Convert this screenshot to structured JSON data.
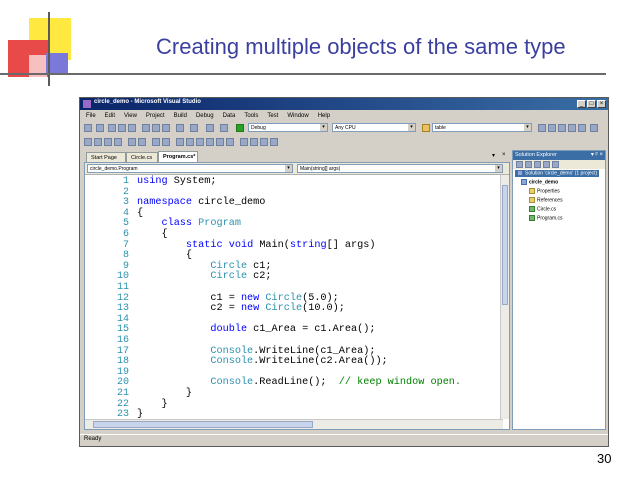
{
  "slide": {
    "title": "Creating multiple objects of the same type",
    "page_number": "30"
  },
  "window": {
    "title": "circle_demo - Microsoft Visual Studio",
    "minimize": "_",
    "restore": "□",
    "close": "×"
  },
  "menu": [
    "File",
    "Edit",
    "View",
    "Project",
    "Build",
    "Debug",
    "Data",
    "Tools",
    "Test",
    "Window",
    "Help"
  ],
  "toolbar": {
    "config": "Debug",
    "platform": "Any CPU",
    "find": "table"
  },
  "tabs": [
    {
      "label": "Start Page"
    },
    {
      "label": "Circle.cs"
    },
    {
      "label": "Program.cs*"
    }
  ],
  "tab_controls": {
    "dropdown": "▾",
    "close": "×"
  },
  "editor": {
    "type_combo": "circle_demo.Program",
    "member_combo": "Main(string[] args)"
  },
  "code": [
    {
      "n": "1",
      "segs": [
        [
          "kw",
          "using"
        ],
        [
          "p",
          " System;"
        ]
      ]
    },
    {
      "n": "2",
      "segs": []
    },
    {
      "n": "3",
      "segs": [
        [
          "kw",
          "namespace"
        ],
        [
          "p",
          " circle_demo"
        ]
      ]
    },
    {
      "n": "4",
      "segs": [
        [
          "p",
          "{"
        ]
      ]
    },
    {
      "n": "5",
      "segs": [
        [
          "p",
          "    "
        ],
        [
          "kw",
          "class"
        ],
        [
          "p",
          " "
        ],
        [
          "ty",
          "Program"
        ]
      ]
    },
    {
      "n": "6",
      "segs": [
        [
          "p",
          "    {"
        ]
      ]
    },
    {
      "n": "7",
      "segs": [
        [
          "p",
          "        "
        ],
        [
          "kw",
          "static"
        ],
        [
          "p",
          " "
        ],
        [
          "kw",
          "void"
        ],
        [
          "p",
          " Main("
        ],
        [
          "kw",
          "string"
        ],
        [
          "p",
          "[] args)"
        ]
      ]
    },
    {
      "n": "8",
      "segs": [
        [
          "p",
          "        {"
        ]
      ]
    },
    {
      "n": "9",
      "segs": [
        [
          "p",
          "            "
        ],
        [
          "ty",
          "Circle"
        ],
        [
          "p",
          " c1;"
        ]
      ]
    },
    {
      "n": "10",
      "segs": [
        [
          "p",
          "            "
        ],
        [
          "ty",
          "Circle"
        ],
        [
          "p",
          " c2;"
        ]
      ]
    },
    {
      "n": "11",
      "segs": []
    },
    {
      "n": "12",
      "segs": [
        [
          "p",
          "            c1 = "
        ],
        [
          "kw",
          "new"
        ],
        [
          "p",
          " "
        ],
        [
          "ty",
          "Circle"
        ],
        [
          "p",
          "(5.0);"
        ]
      ]
    },
    {
      "n": "13",
      "segs": [
        [
          "p",
          "            c2 = "
        ],
        [
          "kw",
          "new"
        ],
        [
          "p",
          " "
        ],
        [
          "ty",
          "Circle"
        ],
        [
          "p",
          "(10.0);"
        ]
      ]
    },
    {
      "n": "14",
      "segs": []
    },
    {
      "n": "15",
      "segs": [
        [
          "p",
          "            "
        ],
        [
          "kw",
          "double"
        ],
        [
          "p",
          " c1_Area = c1.Area();"
        ]
      ]
    },
    {
      "n": "16",
      "segs": []
    },
    {
      "n": "17",
      "segs": [
        [
          "p",
          "            "
        ],
        [
          "ty",
          "Console"
        ],
        [
          "p",
          ".WriteLine(c1_Area);"
        ]
      ]
    },
    {
      "n": "18",
      "segs": [
        [
          "p",
          "            "
        ],
        [
          "ty",
          "Console"
        ],
        [
          "p",
          ".WriteLine(c2.Area());"
        ]
      ]
    },
    {
      "n": "19",
      "segs": []
    },
    {
      "n": "20",
      "segs": [
        [
          "p",
          "            "
        ],
        [
          "ty",
          "Console"
        ],
        [
          "p",
          ".ReadLine();  "
        ],
        [
          "cm",
          "// keep window open."
        ]
      ]
    },
    {
      "n": "21",
      "segs": [
        [
          "p",
          "        }"
        ]
      ]
    },
    {
      "n": "22",
      "segs": [
        [
          "p",
          "    }"
        ]
      ]
    },
    {
      "n": "23",
      "segs": [
        [
          "p",
          "}"
        ]
      ]
    }
  ],
  "solution_explorer": {
    "title": "Solution Explorer",
    "controls": "▾ ᵖ ×",
    "items": [
      {
        "label": "Solution 'circle_demo' (1 project)",
        "icon": "solution-icon"
      },
      {
        "label": "circle_demo",
        "icon": "project-icon"
      },
      {
        "label": "Properties",
        "icon": "folder-icon"
      },
      {
        "label": "References",
        "icon": "folder-icon"
      },
      {
        "label": "Circle.cs",
        "icon": "csharp-file-icon"
      },
      {
        "label": "Program.cs",
        "icon": "csharp-file-icon"
      }
    ]
  },
  "status": "Ready"
}
